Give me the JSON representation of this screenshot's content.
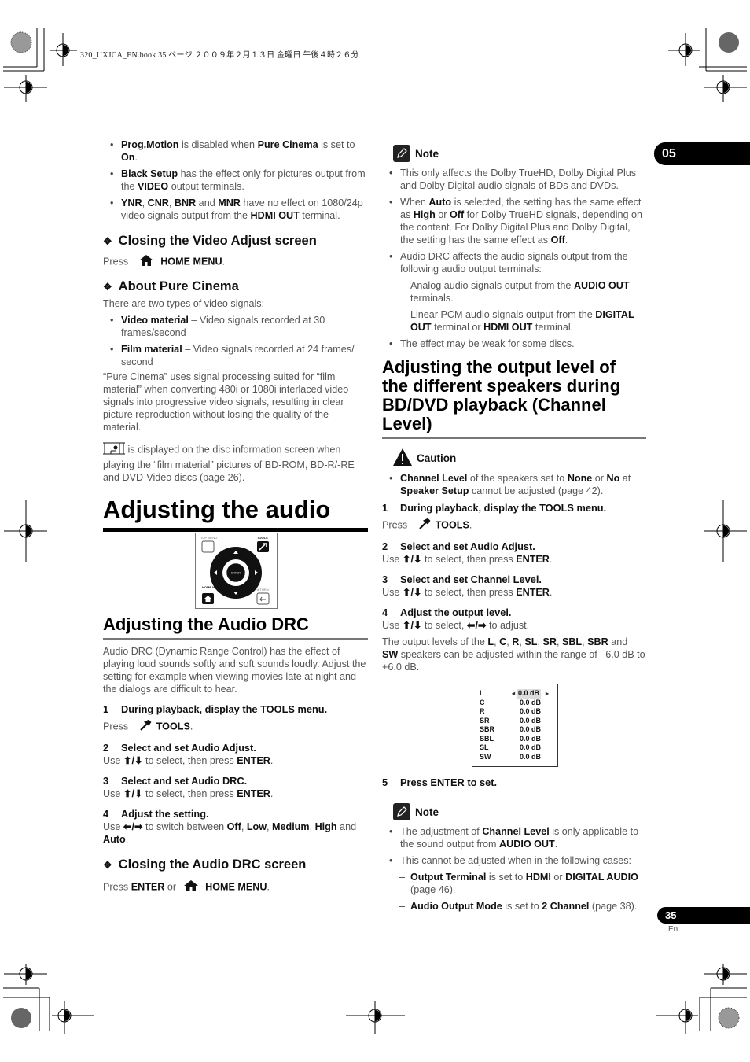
{
  "print_header": "320_UXJCA_EN.book  35 ページ  ２００９年２月１３日  金曜日  午後４時２６分",
  "chapter_tab": "05",
  "page_number": "35",
  "language": "En",
  "left": {
    "bullets_top": [
      {
        "runs": [
          [
            "b",
            "Prog.Motion"
          ],
          [
            "t",
            " is disabled when "
          ],
          [
            "b",
            "Pure Cinema"
          ],
          [
            "t",
            " is set to "
          ],
          [
            "b",
            "On"
          ],
          [
            "t",
            "."
          ]
        ]
      },
      {
        "runs": [
          [
            "b",
            "Black Setup"
          ],
          [
            "t",
            " has the effect only for pictures output from the "
          ],
          [
            "b",
            "VIDEO"
          ],
          [
            "t",
            " output terminals."
          ]
        ]
      },
      {
        "runs": [
          [
            "b",
            "YNR"
          ],
          [
            "t",
            ", "
          ],
          [
            "b",
            "CNR"
          ],
          [
            "t",
            ", "
          ],
          [
            "b",
            "BNR"
          ],
          [
            "t",
            " and "
          ],
          [
            "b",
            "MNR"
          ],
          [
            "t",
            " have no effect on 1080/24p video signals output from the "
          ],
          [
            "b",
            "HDMI OUT"
          ],
          [
            "t",
            " terminal."
          ]
        ]
      }
    ],
    "closing_video_heading": "Closing the Video Adjust screen",
    "closing_video_press": "Press",
    "closing_video_button": "HOME MENU",
    "about_pure_cinema_heading": "About Pure Cinema",
    "pure_cinema_intro": "There are two types of video signals:",
    "pure_cinema_bullets": [
      {
        "runs": [
          [
            "b",
            "Video material"
          ],
          [
            "t",
            " – Video signals recorded at 30 frames/second"
          ]
        ]
      },
      {
        "runs": [
          [
            "b",
            "Film material"
          ],
          [
            "t",
            " – Video signals recorded at 24 frames/ second"
          ]
        ]
      }
    ],
    "pure_cinema_para": "“Pure Cinema” uses signal processing suited for “film material” when converting 480i or 1080i interlaced video signals into progressive video signals, resulting in clear picture reproduction without losing the quality of the material.",
    "film_icon_para": " is displayed on the disc information screen when playing the “film material” pictures of BD-ROM, BD-R/-RE and DVD-Video discs (page 26).",
    "adjusting_audio_heading": "Adjusting the audio",
    "remote": {
      "top_menu": "TOP MENU",
      "tools": "TOOLS",
      "enter": "ENTER",
      "home_menu": "HOME MENU",
      "return": "RETURN"
    },
    "audio_drc_heading": "Adjusting the Audio DRC",
    "audio_drc_para": "Audio DRC (Dynamic Range Control) has the effect of playing loud sounds softly and soft sounds loudly. Adjust the setting for example when viewing movies late at night and the dialogs are difficult to hear.",
    "steps": [
      {
        "num": "1",
        "title": "During playback, display the TOOLS menu.",
        "press": "Press",
        "button": "TOOLS"
      },
      {
        "num": "2",
        "title": "Select and set Audio Adjust.",
        "use": "Use",
        "tail": " to select, then press ",
        "key": "ENTER"
      },
      {
        "num": "3",
        "title": "Select and set Audio DRC.",
        "use": "Use",
        "tail": " to select, then press ",
        "key": "ENTER"
      },
      {
        "num": "4",
        "title": "Adjust the setting.",
        "runs": [
          [
            "t",
            " to switch between "
          ],
          [
            "b",
            "Off"
          ],
          [
            "t",
            ", "
          ],
          [
            "b",
            "Low"
          ],
          [
            "t",
            ", "
          ],
          [
            "b",
            "Medium"
          ],
          [
            "t",
            ", "
          ],
          [
            "b",
            "High"
          ],
          [
            "t",
            " and "
          ],
          [
            "b",
            "Auto"
          ],
          [
            "t",
            "."
          ]
        ]
      }
    ],
    "closing_drc_heading": "Closing the Audio DRC screen",
    "closing_drc_press": "Press",
    "closing_drc_enter": "ENTER",
    "closing_drc_or": " or ",
    "closing_drc_button": "HOME MENU"
  },
  "right": {
    "note1_title": "Note",
    "note1_bullets": [
      {
        "runs": [
          [
            "t",
            "This only affects the Dolby TrueHD, Dolby Digital Plus and Dolby Digital audio signals of BDs and DVDs."
          ]
        ]
      },
      {
        "runs": [
          [
            "t",
            "When "
          ],
          [
            "b",
            "Auto"
          ],
          [
            "t",
            " is selected, the setting has the same effect as "
          ],
          [
            "b",
            "High"
          ],
          [
            "t",
            " or "
          ],
          [
            "b",
            "Off"
          ],
          [
            "t",
            " for Dolby TrueHD signals, depending on the content. For Dolby Digital Plus and Dolby Digital, the setting has the same effect as "
          ],
          [
            "b",
            "Off"
          ],
          [
            "t",
            "."
          ]
        ]
      },
      {
        "runs": [
          [
            "t",
            "Audio DRC affects the audio signals output from the following audio output terminals:"
          ]
        ]
      }
    ],
    "note1_dashes": [
      {
        "runs": [
          [
            "t",
            "Analog audio signals output from the "
          ],
          [
            "b",
            "AUDIO OUT"
          ],
          [
            "t",
            " terminals."
          ]
        ]
      },
      {
        "runs": [
          [
            "t",
            "Linear PCM audio signals output from the "
          ],
          [
            "b",
            "DIGITAL OUT"
          ],
          [
            "t",
            " terminal or "
          ],
          [
            "b",
            "HDMI OUT"
          ],
          [
            "t",
            " terminal."
          ]
        ]
      }
    ],
    "note1_last": "The effect may be weak for some discs.",
    "channel_heading": "Adjusting the output level of the different speakers during BD/DVD playback (Channel Level)",
    "caution_title": "Caution",
    "caution_bullet": {
      "runs": [
        [
          "b",
          "Channel Level"
        ],
        [
          "t",
          " of the speakers set to "
        ],
        [
          "b",
          "None"
        ],
        [
          "t",
          " or "
        ],
        [
          "b",
          "No"
        ],
        [
          "t",
          " at "
        ],
        [
          "b",
          "Speaker Setup"
        ],
        [
          "t",
          " cannot be adjusted (page 42)."
        ]
      ]
    },
    "steps": [
      {
        "num": "1",
        "title": "During playback, display the TOOLS menu.",
        "press": "Press",
        "button": "TOOLS"
      },
      {
        "num": "2",
        "title": "Select and set Audio Adjust.",
        "use": "Use",
        "tail": " to select, then press ",
        "key": "ENTER"
      },
      {
        "num": "3",
        "title": "Select and set Channel Level.",
        "use": "Use",
        "tail": " to select, then press ",
        "key": "ENTER"
      },
      {
        "num": "4",
        "title": "Adjust the output level.",
        "use": "Use",
        "mid": " to select, ",
        "tail": " to adjust."
      },
      {
        "num": "5",
        "title": "Press ENTER to set."
      }
    ],
    "levels_para": {
      "runs": [
        [
          "t",
          "The output levels of the "
        ],
        [
          "b",
          "L"
        ],
        [
          "t",
          ", "
        ],
        [
          "b",
          "C"
        ],
        [
          "t",
          ", "
        ],
        [
          "b",
          "R"
        ],
        [
          "t",
          ", "
        ],
        [
          "b",
          "SL"
        ],
        [
          "t",
          ", "
        ],
        [
          "b",
          "SR"
        ],
        [
          "t",
          ", "
        ],
        [
          "b",
          "SBL"
        ],
        [
          "t",
          ", "
        ],
        [
          "b",
          "SBR"
        ],
        [
          "t",
          " and "
        ],
        [
          "b",
          "SW"
        ],
        [
          "t",
          " speakers can be adjusted within the range of –6.0 dB to +6.0 dB."
        ]
      ]
    },
    "channel_levels": [
      {
        "ch": "L",
        "value": "0.0 dB",
        "selected": true
      },
      {
        "ch": "C",
        "value": "0.0 dB"
      },
      {
        "ch": "R",
        "value": "0.0 dB"
      },
      {
        "ch": "SR",
        "value": "0.0 dB"
      },
      {
        "ch": "SBR",
        "value": "0.0 dB"
      },
      {
        "ch": "SBL",
        "value": "0.0 dB"
      },
      {
        "ch": "SL",
        "value": "0.0 dB"
      },
      {
        "ch": "SW",
        "value": "0.0 dB"
      }
    ],
    "note2_title": "Note",
    "note2_bullets": [
      {
        "runs": [
          [
            "t",
            "The adjustment of "
          ],
          [
            "b",
            "Channel Level"
          ],
          [
            "t",
            " is only applicable to the sound output from "
          ],
          [
            "b",
            "AUDIO OUT"
          ],
          [
            "t",
            "."
          ]
        ]
      },
      {
        "runs": [
          [
            "t",
            "This cannot be adjusted when in the following cases:"
          ]
        ]
      }
    ],
    "note2_dashes": [
      {
        "runs": [
          [
            "b",
            "Output Terminal"
          ],
          [
            "t",
            " is set to "
          ],
          [
            "b",
            "HDMI"
          ],
          [
            "t",
            " or "
          ],
          [
            "b",
            "DIGITAL AUDIO"
          ],
          [
            "t",
            " (page 46)."
          ]
        ]
      },
      {
        "runs": [
          [
            "b",
            "Audio Output Mode"
          ],
          [
            "t",
            " is set to "
          ],
          [
            "b",
            "2 Channel"
          ],
          [
            "t",
            " (page 38)."
          ]
        ]
      }
    ]
  }
}
